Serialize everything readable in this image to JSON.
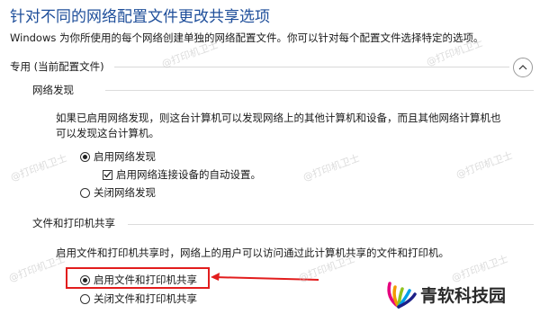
{
  "page": {
    "title": "针对不同的网络配置文件更改共享选项",
    "subtitle": "Windows 为你所使用的每个网络创建单独的网络配置文件。你可以针对每个配置文件选择特定的选项。"
  },
  "private_profile": {
    "label": "专用 (当前配置文件)",
    "collapse_icon": "chevron-up-icon",
    "network_discovery": {
      "heading": "网络发现",
      "description_line1": "如果已启用网络发现，则这台计算机可以发现网络上的其他计算机和设备，而且其他网络计算机也",
      "description_line2": "可以发现这台计算机。",
      "options": [
        {
          "label": "启用网络发现",
          "selected": true
        },
        {
          "label": "关闭网络发现",
          "selected": false
        }
      ],
      "auto_setup": {
        "label": "启用网络连接设备的自动设置。",
        "checked": true
      }
    },
    "file_printer_sharing": {
      "heading": "文件和打印机共享",
      "description": "启用文件和打印机共享时，网络上的用户可以访问通过此计算机共享的文件和打印机。",
      "options": [
        {
          "label": "启用文件和打印机共享",
          "selected": true
        },
        {
          "label": "关闭文件和打印机共享",
          "selected": false
        }
      ]
    }
  },
  "annotation": {
    "highlight_color": "#e21d1d"
  },
  "watermark": {
    "text": "@打印机卫士"
  },
  "brand": {
    "name": "青软科技园",
    "icon": "signal-logo-icon"
  }
}
